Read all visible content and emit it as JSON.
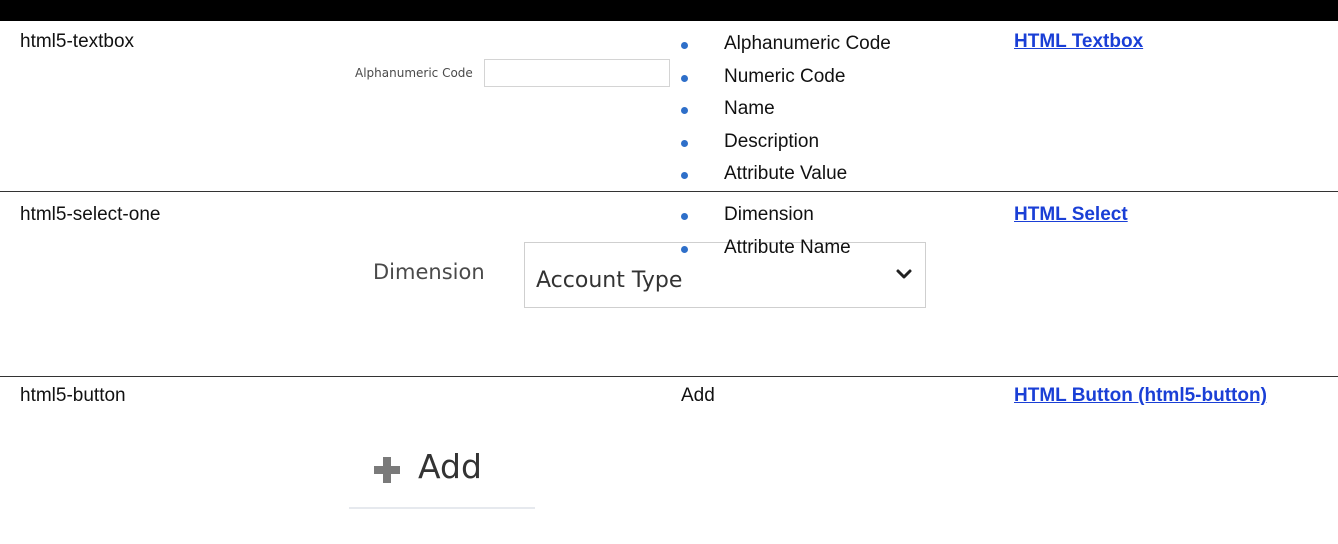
{
  "rows": [
    {
      "type_name": "html5-textbox",
      "preview": {
        "label": "Alphanumeric Code",
        "value": ""
      },
      "items": [
        "Alphanumeric Code",
        "Numeric Code",
        "Name",
        "Description",
        "Attribute Value"
      ],
      "link": "HTML Textbox"
    },
    {
      "type_name": "html5-select-one",
      "preview": {
        "label": "Dimension",
        "value": "Account Type"
      },
      "items": [
        "Dimension",
        "Attribute Name"
      ],
      "link": "HTML Select"
    },
    {
      "type_name": "html5-button",
      "preview": {
        "label": "Add"
      },
      "value_text": "Add",
      "link": "HTML Button (html5-button)"
    }
  ],
  "colors": {
    "bullet": "#2e6fc9",
    "link": "#1a3fd6",
    "header_bar": "#000000"
  },
  "icons": {
    "select_chevron": "chevron-down-icon",
    "button_plus": "plus-icon"
  }
}
